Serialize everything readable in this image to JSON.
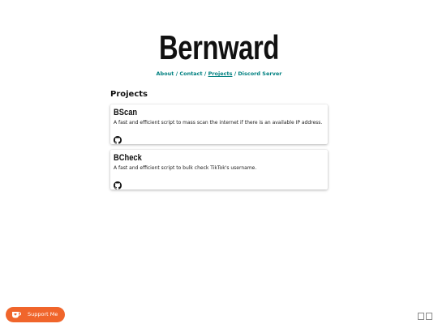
{
  "site": {
    "title": "Bernward"
  },
  "nav": {
    "items": [
      {
        "label": "About"
      },
      {
        "label": "Contact"
      },
      {
        "label": "Projects",
        "current": true
      },
      {
        "label": "Discord Server"
      }
    ],
    "separator": "/"
  },
  "projects": {
    "heading": "Projects",
    "items": [
      {
        "name": "BScan",
        "description": "A fast and efficient script to mass scan the internet if there is an available IP address.",
        "icon": "github-icon"
      },
      {
        "name": "BCheck",
        "description": "A fast and efficient script to bulk check TikTok's username.",
        "icon": "github-icon"
      }
    ]
  },
  "support": {
    "label": "Support Me",
    "icon": "ko-fi-cup-icon"
  },
  "colors": {
    "accent": "#008080",
    "support": "#f0652b",
    "text": "#111111",
    "background": "#ffffff"
  }
}
